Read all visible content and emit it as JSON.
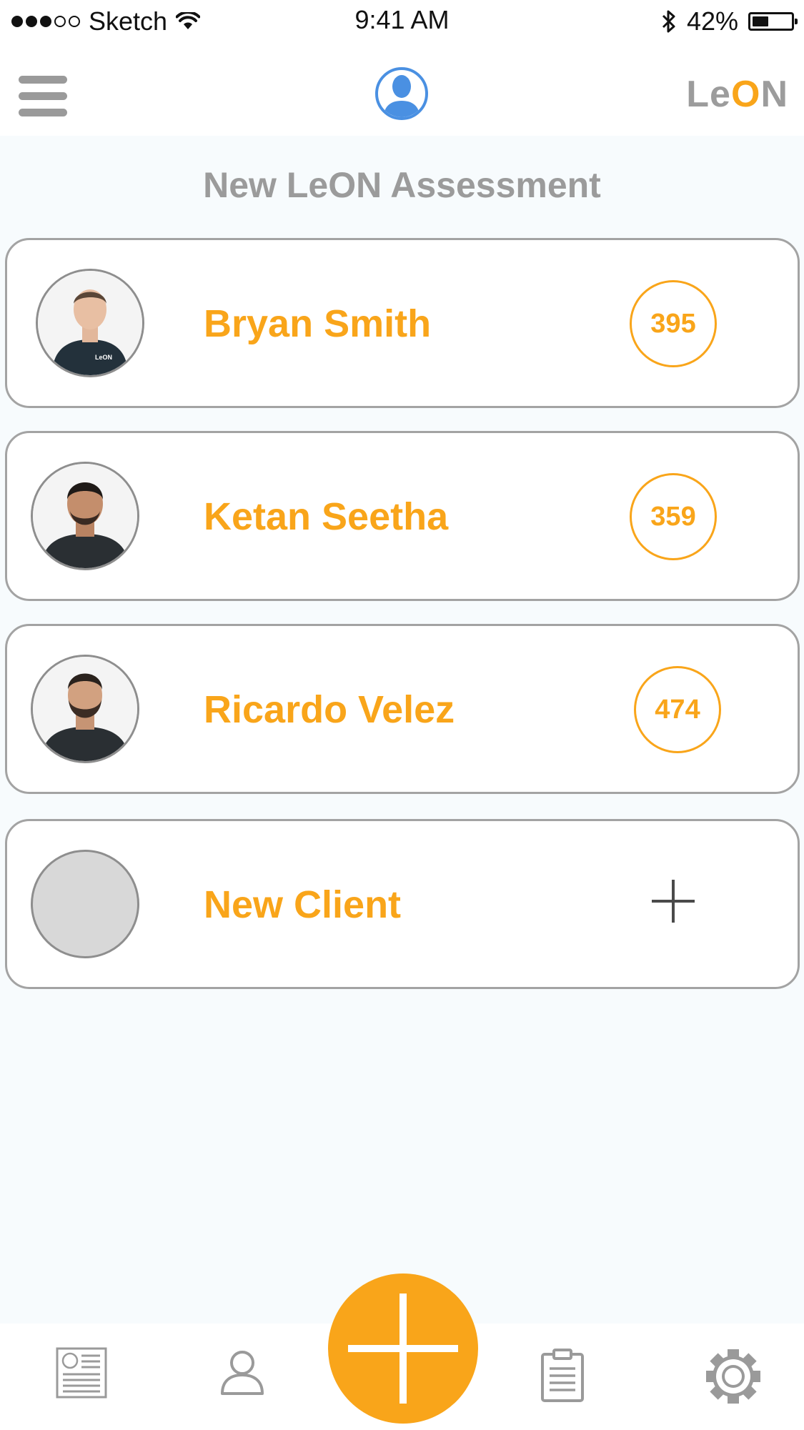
{
  "status_bar": {
    "carrier": "Sketch",
    "time": "9:41 AM",
    "battery_percent": "42%",
    "battery_level": 0.42,
    "signal_bars_filled": 3,
    "signal_bars_total": 5
  },
  "nav_bar": {
    "menu_icon": "hamburger-menu-icon",
    "profile_icon": "user-silhouette-icon",
    "brand": {
      "prefix": "Le",
      "accent": "O",
      "suffix": "N"
    }
  },
  "page": {
    "title": "New LeON Assessment"
  },
  "clients": [
    {
      "name": "Bryan Smith",
      "score": "395"
    },
    {
      "name": "Ketan Seetha",
      "score": "359"
    },
    {
      "name": "Ricardo Velez",
      "score": "474"
    }
  ],
  "new_client": {
    "label": "New Client",
    "icon": "plus-icon"
  },
  "tab_bar": {
    "items": [
      {
        "icon": "news-document-icon"
      },
      {
        "icon": "person-icon"
      },
      {
        "icon": "add-assessment-icon"
      },
      {
        "icon": "clipboard-icon"
      },
      {
        "icon": "gear-icon"
      }
    ]
  },
  "colors": {
    "accent": "#F9A51A",
    "muted_text": "#9B9B9B",
    "card_border": "#A3A3A3",
    "profile_blue": "#4A90E2",
    "background": "#F7FBFD"
  }
}
